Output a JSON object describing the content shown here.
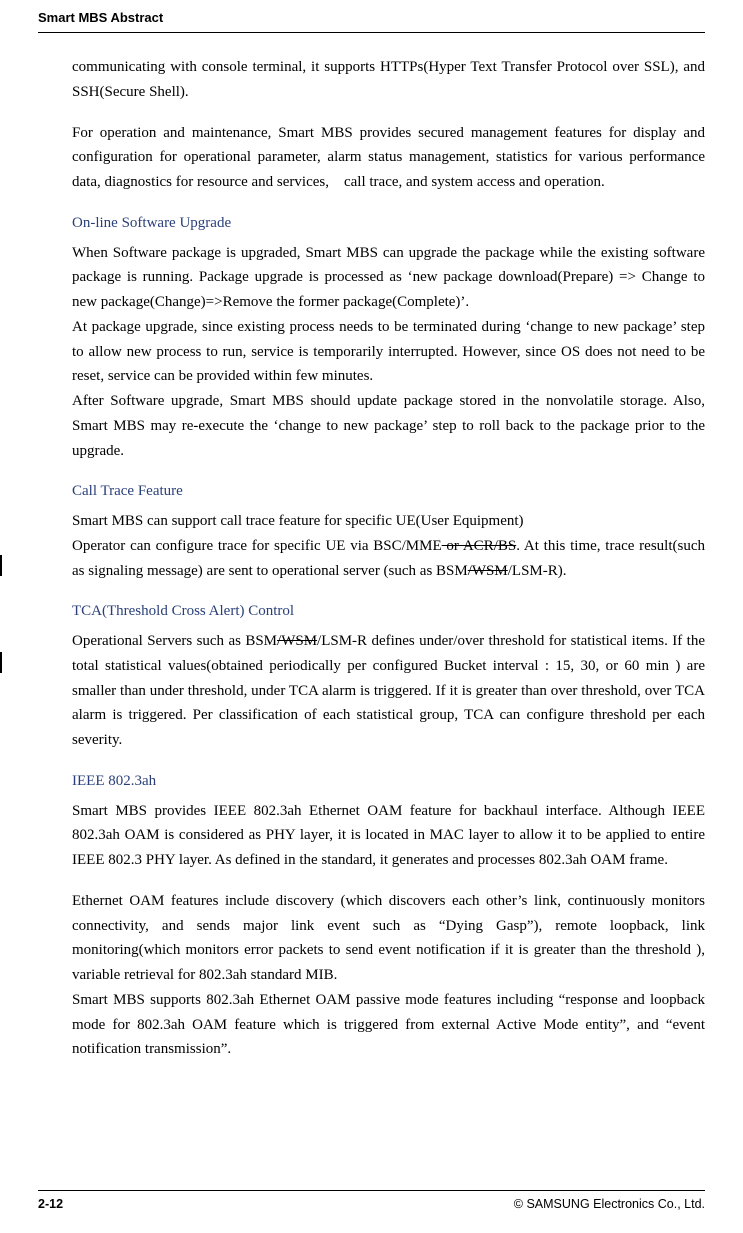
{
  "header": "Smart MBS Abstract",
  "p1": "communicating with console terminal, it supports HTTPs(Hyper Text Transfer Protocol over SSL), and SSH(Secure Shell).",
  "p2": "For operation and maintenance, Smart MBS provides secured management features for display and configuration for operational parameter, alarm status management, statistics for various performance data, diagnostics for resource and services, call trace, and system access and operation.",
  "s1_title": "On-line Software Upgrade",
  "s1_p1": "When Software package is upgraded, Smart MBS can upgrade the package while the existing software package is running. Package upgrade is processed as ‘new package download(Prepare) => Change to new package(Change)=>Remove the former package(Complete)’.",
  "s1_p2": "At package upgrade, since existing process needs to be terminated during ‘change to new package’ step to allow new process to run, service is temporarily interrupted. However, since OS does not need to be reset, service can be provided within few minutes.",
  "s1_p3": "After Software upgrade, Smart MBS should update package stored in the nonvolatile storage. Also, Smart MBS may re-execute the ‘change to new package’ step to roll back to the package prior to the upgrade.",
  "s2_title": "Call Trace Feature",
  "s2_p1a": "Smart MBS can support call trace feature for specific UE(User Equipment)",
  "s2_p1b_pre": "Operator can configure trace for specific UE via BSC/MME",
  "s2_p1b_strike": " or ACR/BS",
  "s2_p1b_post": ". At this time, trace result(such as signaling message) are sent to operational server (such as BSM",
  "s2_p1b_strike2": "/WSM",
  "s2_p1b_end": "/LSM-R).",
  "s3_title": "TCA(Threshold Cross Alert) Control",
  "s3_p1_pre": "Operational Servers such as BSM",
  "s3_p1_strike": "/WSM",
  "s3_p1_post": "/LSM-R defines under/over threshold for statistical items. If the total statistical values(obtained periodically per configured Bucket interval : 15, 30, or 60 min ) are smaller than under threshold, under TCA alarm is triggered. If it is greater than over threshold, over TCA alarm is triggered. Per classification of each statistical group, TCA can configure threshold per each severity.",
  "s4_title": "IEEE 802.3ah",
  "s4_p1": "Smart MBS provides IEEE 802.3ah Ethernet OAM feature for backhaul interface. Although IEEE 802.3ah OAM is considered as PHY layer, it is located in MAC layer to allow it to be applied to entire IEEE 802.3 PHY layer. As defined in the standard, it generates and processes 802.3ah OAM frame.",
  "s4_p2": "Ethernet OAM features include discovery (which discovers each other’s link, continuously monitors connectivity, and sends major link event such as “Dying Gasp”), remote loopback, link monitoring(which monitors error packets to send event notification if it is greater than the threshold ), variable retrieval for 802.3ah standard MIB.",
  "s4_p3": "Smart MBS supports 802.3ah Ethernet OAM passive mode features including “response and loopback mode for 802.3ah OAM feature which is triggered from external Active Mode entity”, and “event notification transmission”.",
  "footer_left": "2-12",
  "footer_right": "© SAMSUNG Electronics Co., Ltd."
}
